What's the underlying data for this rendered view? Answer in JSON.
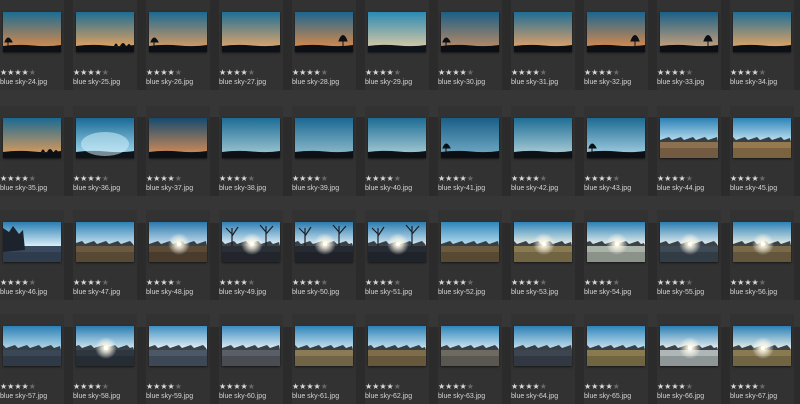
{
  "rating_colors": {
    "filled": "#d8d8d8",
    "empty": "#6a6a6a"
  },
  "thumbnails": [
    {
      "filename": "blue sky-24.jpg",
      "rating": 4,
      "scene": "dusk",
      "sky": [
        "#1d6c92",
        "#d98a4a"
      ],
      "fg": "#0d1015",
      "feature": "tree-left"
    },
    {
      "filename": "blue sky-25.jpg",
      "rating": 4,
      "scene": "dusk",
      "sky": [
        "#1e6d94",
        "#e5a25e"
      ],
      "fg": "#0c0f14",
      "feature": "trees-right"
    },
    {
      "filename": "blue sky-26.jpg",
      "rating": 4,
      "scene": "dusk",
      "sky": [
        "#1b6a93",
        "#d69a62"
      ],
      "fg": "#0c0f14",
      "feature": "tree-left"
    },
    {
      "filename": "blue sky-27.jpg",
      "rating": 4,
      "scene": "dusk",
      "sky": [
        "#1e6f96",
        "#e0a56c"
      ],
      "fg": "#0d1016",
      "feature": "flat"
    },
    {
      "filename": "blue sky-28.jpg",
      "rating": 4,
      "scene": "dusk",
      "sky": [
        "#1c6690",
        "#d9894a"
      ],
      "fg": "#0c0f14",
      "feature": "tree-right"
    },
    {
      "filename": "blue sky-29.jpg",
      "rating": 4,
      "scene": "dusk",
      "sky": [
        "#2a8ab4",
        "#d9c9a5"
      ],
      "fg": "#0e141b",
      "feature": "flat"
    },
    {
      "filename": "blue sky-30.jpg",
      "rating": 4,
      "scene": "dusk",
      "sky": [
        "#1a5f86",
        "#b98a66"
      ],
      "fg": "#0b0e13",
      "feature": "tree-left"
    },
    {
      "filename": "blue sky-31.jpg",
      "rating": 4,
      "scene": "dusk",
      "sky": [
        "#1f6d95",
        "#e1a268"
      ],
      "fg": "#0c1015",
      "feature": "flat"
    },
    {
      "filename": "blue sky-32.jpg",
      "rating": 4,
      "scene": "dusk",
      "sky": [
        "#1c6590",
        "#d9894c"
      ],
      "fg": "#0c0f14",
      "feature": "tree-right"
    },
    {
      "filename": "blue sky-33.jpg",
      "rating": 4,
      "scene": "dusk",
      "sky": [
        "#1a6088",
        "#c8a07a"
      ],
      "fg": "#0b0e13",
      "feature": "tree-right"
    },
    {
      "filename": "blue sky-34.jpg",
      "rating": 4,
      "scene": "dusk",
      "sky": [
        "#1e6e96",
        "#e3a464"
      ],
      "fg": "#0c0f14",
      "feature": "flat"
    },
    {
      "filename": "blue sky-35.jpg",
      "rating": 4,
      "scene": "dusk",
      "sky": [
        "#1b6a93",
        "#d89a5c"
      ],
      "fg": "#0c0f14",
      "feature": "trees-right"
    },
    {
      "filename": "blue sky-36.jpg",
      "rating": 4,
      "scene": "dusk",
      "sky": [
        "#1a6a96",
        "#9fd6ec"
      ],
      "fg": "#0e131a",
      "feature": "glow"
    },
    {
      "filename": "blue sky-37.jpg",
      "rating": 4,
      "scene": "dusk",
      "sky": [
        "#164a6e",
        "#d08a58"
      ],
      "fg": "#0c0f14",
      "feature": "flat"
    },
    {
      "filename": "blue sky-38.jpg",
      "rating": 4,
      "scene": "dusk",
      "sky": [
        "#1d6d95",
        "#9bc4d0"
      ],
      "fg": "#0d1116",
      "feature": "flat"
    },
    {
      "filename": "blue sky-39.jpg",
      "rating": 4,
      "scene": "dusk",
      "sky": [
        "#1b6892",
        "#8ab9c9"
      ],
      "fg": "#0d1116",
      "feature": "flat"
    },
    {
      "filename": "blue sky-40.jpg",
      "rating": 4,
      "scene": "dusk",
      "sky": [
        "#1d6c94",
        "#a2c9d3"
      ],
      "fg": "#0d1116",
      "feature": "flat"
    },
    {
      "filename": "blue sky-41.jpg",
      "rating": 4,
      "scene": "dusk",
      "sky": [
        "#1a5f88",
        "#6fa7c2"
      ],
      "fg": "#0b0e13",
      "feature": "tree-left"
    },
    {
      "filename": "blue sky-42.jpg",
      "rating": 4,
      "scene": "dusk",
      "sky": [
        "#1e6d95",
        "#a8ccd6"
      ],
      "fg": "#0d1116",
      "feature": "flat"
    },
    {
      "filename": "blue sky-43.jpg",
      "rating": 4,
      "scene": "dusk",
      "sky": [
        "#1d6a93",
        "#9ecbe0"
      ],
      "fg": "#0c0f14",
      "feature": "tree-left"
    },
    {
      "filename": "blue sky-44.jpg",
      "rating": 4,
      "scene": "field",
      "sky": [
        "#2a7fb4",
        "#bfe2f2"
      ],
      "fg": "#8c7050",
      "feature": "treeline"
    },
    {
      "filename": "blue sky-45.jpg",
      "rating": 4,
      "scene": "field",
      "sky": [
        "#2b83b8",
        "#c6e5f3"
      ],
      "fg": "#96794f",
      "feature": "treeline"
    },
    {
      "filename": "blue sky-46.jpg",
      "rating": 4,
      "scene": "field",
      "sky": [
        "#2a7db2",
        "#d8eef7"
      ],
      "fg": "#3a4a5e",
      "feature": "forest-left"
    },
    {
      "filename": "blue sky-47.jpg",
      "rating": 4,
      "scene": "field",
      "sky": [
        "#2c80b5",
        "#cfe6f1"
      ],
      "fg": "#6c5a40",
      "feature": "treeline"
    },
    {
      "filename": "blue sky-48.jpg",
      "rating": 4,
      "scene": "sun",
      "sky": [
        "#2a78ad",
        "#cfe4ef"
      ],
      "fg": "#5a4a36",
      "feature": "treeline"
    },
    {
      "filename": "blue sky-49.jpg",
      "rating": 4,
      "scene": "sun",
      "sky": [
        "#2e7fb5",
        "#eaf4f8"
      ],
      "fg": "#2a2f36",
      "feature": "bare-trees"
    },
    {
      "filename": "blue sky-50.jpg",
      "rating": 4,
      "scene": "sun",
      "sky": [
        "#2a7aae",
        "#e4f1f7"
      ],
      "fg": "#262b33",
      "feature": "bare-trees"
    },
    {
      "filename": "blue sky-51.jpg",
      "rating": 4,
      "scene": "sun",
      "sky": [
        "#2b7cb0",
        "#dcedf5"
      ],
      "fg": "#272c34",
      "feature": "bare-trees"
    },
    {
      "filename": "blue sky-52.jpg",
      "rating": 4,
      "scene": "field",
      "sky": [
        "#2c85bb",
        "#bfe0f0"
      ],
      "fg": "#6b5a3e",
      "feature": "treeline"
    },
    {
      "filename": "blue sky-53.jpg",
      "rating": 4,
      "scene": "sun",
      "sky": [
        "#2d84ba",
        "#f4f4e8"
      ],
      "fg": "#8a7a52",
      "feature": "treeline"
    },
    {
      "filename": "blue sky-54.jpg",
      "rating": 4,
      "scene": "sun",
      "sky": [
        "#2b7fb4",
        "#f2f6f0"
      ],
      "fg": "#aab3a8",
      "feature": "treeline"
    },
    {
      "filename": "blue sky-55.jpg",
      "rating": 4,
      "scene": "sun",
      "sky": [
        "#2a7cb1",
        "#eef4f2"
      ],
      "fg": "#3e4a55",
      "feature": "treeline"
    },
    {
      "filename": "blue sky-56.jpg",
      "rating": 4,
      "scene": "sun",
      "sky": [
        "#2c81b6",
        "#f0f3ea"
      ],
      "fg": "#7a6a4a",
      "feature": "treeline"
    },
    {
      "filename": "blue sky-57.jpg",
      "rating": 4,
      "scene": "field",
      "sky": [
        "#2b80b6",
        "#bcdcec"
      ],
      "fg": "#3a4756",
      "feature": "treeline"
    },
    {
      "filename": "blue sky-58.jpg",
      "rating": 4,
      "scene": "sun",
      "sky": [
        "#2a7cb2",
        "#d9ecf5"
      ],
      "fg": "#2e3640",
      "feature": "treeline"
    },
    {
      "filename": "blue sky-59.jpg",
      "rating": 4,
      "scene": "field",
      "sky": [
        "#3d8fc2",
        "#eef6fa"
      ],
      "fg": "#4a5868",
      "feature": "treeline"
    },
    {
      "filename": "blue sky-60.jpg",
      "rating": 4,
      "scene": "field",
      "sky": [
        "#3b8cc0",
        "#e8f2f7"
      ],
      "fg": "#5a5e66",
      "feature": "treeline"
    },
    {
      "filename": "blue sky-61.jpg",
      "rating": 4,
      "scene": "field",
      "sky": [
        "#2e84ba",
        "#d2e8f3"
      ],
      "fg": "#8a7a56",
      "feature": "treeline"
    },
    {
      "filename": "blue sky-62.jpg",
      "rating": 4,
      "scene": "field",
      "sky": [
        "#2d82b8",
        "#cfe6f2"
      ],
      "fg": "#7e6c4a",
      "feature": "treeline"
    },
    {
      "filename": "blue sky-63.jpg",
      "rating": 4,
      "scene": "field",
      "sky": [
        "#2f86bc",
        "#d6eaf4"
      ],
      "fg": "#6e6a62",
      "feature": "treeline"
    },
    {
      "filename": "blue sky-64.jpg",
      "rating": 4,
      "scene": "field",
      "sky": [
        "#2c80b5",
        "#cbe3ef"
      ],
      "fg": "#3c4550",
      "feature": "treeline"
    },
    {
      "filename": "blue sky-65.jpg",
      "rating": 4,
      "scene": "field",
      "sky": [
        "#2e85bb",
        "#d2e7f2"
      ],
      "fg": "#8a7a50",
      "feature": "treeline"
    },
    {
      "filename": "blue sky-66.jpg",
      "rating": 4,
      "scene": "sun",
      "sky": [
        "#2b7fb5",
        "#f1f5f2"
      ],
      "fg": "#aeb6b8",
      "feature": "treeline"
    },
    {
      "filename": "blue sky-67.jpg",
      "rating": 4,
      "scene": "sun",
      "sky": [
        "#2b80b6",
        "#f0f4ee"
      ],
      "fg": "#8a7a52",
      "feature": "treeline"
    }
  ]
}
